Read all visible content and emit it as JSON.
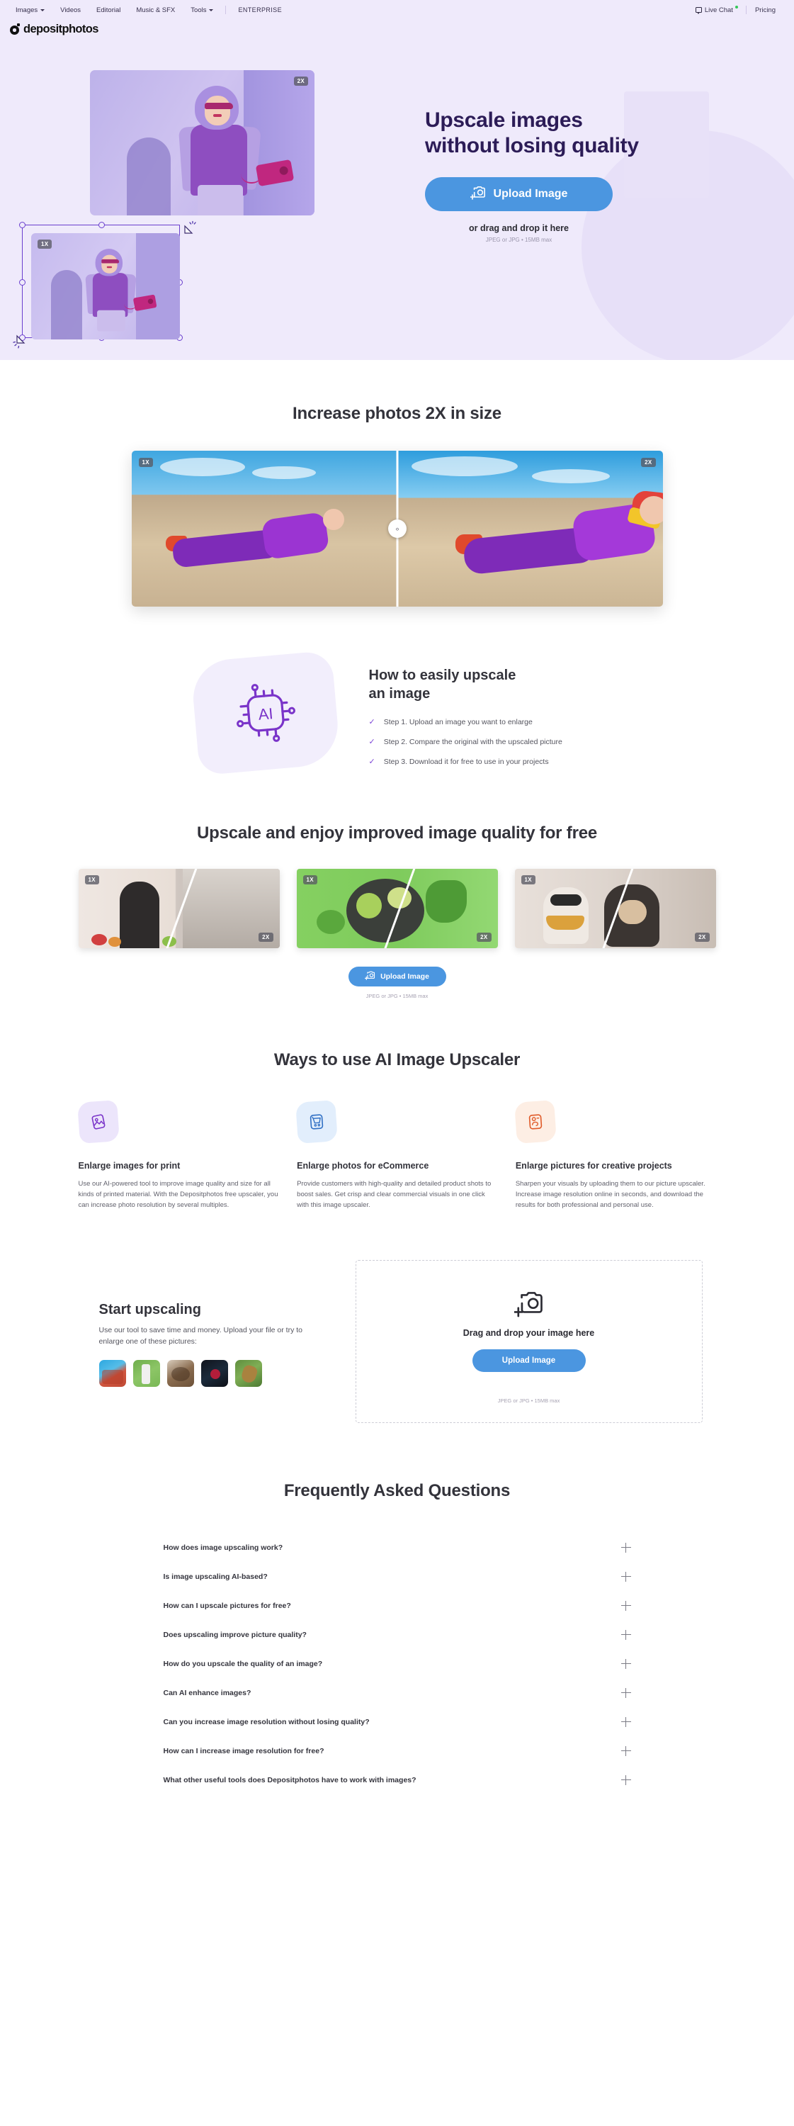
{
  "topbar": {
    "nav": [
      {
        "label": "Images",
        "has_caret": true
      },
      {
        "label": "Videos",
        "has_caret": false
      },
      {
        "label": "Editorial",
        "has_caret": false
      },
      {
        "label": "Music & SFX",
        "has_caret": false
      },
      {
        "label": "Tools",
        "has_caret": true
      }
    ],
    "enterprise": "ENTERPRISE",
    "live_chat": "Live Chat",
    "pricing": "Pricing"
  },
  "brand": {
    "name": "depositphotos"
  },
  "hero": {
    "title_line1": "Upscale images",
    "title_line2": "without losing quality",
    "upload_button": "Upload Image",
    "subtitle": "or drag and drop it here",
    "note": "JPEG or JPG • 15MB max",
    "badge_2x": "2X",
    "badge_1x": "1X"
  },
  "compare": {
    "title": "Increase photos 2X in size",
    "badge_left": "1X",
    "badge_right": "2X",
    "handle_glyph": "‹›"
  },
  "how": {
    "title_line1": "How to easily upscale",
    "title_line2": "an image",
    "icon_label": "AI",
    "steps": [
      "Step 1. Upload an image you want to enlarge",
      "Step 2. Compare the original with the upscaled picture",
      "Step 3. Download it for free to use in your projects"
    ]
  },
  "gallery": {
    "title": "Upscale and enjoy improved image quality for free",
    "cards": [
      {
        "badge_left": "1X",
        "badge_right": "2X"
      },
      {
        "badge_left": "1X",
        "badge_right": "2X"
      },
      {
        "badge_left": "1X",
        "badge_right": "2X"
      }
    ],
    "upload_button": "Upload Image",
    "note": "JPEG or JPG • 15MB max"
  },
  "ways": {
    "title": "Ways to use AI Image Upscaler",
    "items": [
      {
        "icon": "print-image-icon",
        "title": "Enlarge images for print",
        "text": "Use our AI-powered tool to improve image quality and size for all kinds of printed material. With the Depositphotos free upscaler, you can increase photo resolution by several multiples."
      },
      {
        "icon": "shopping-cart-icon",
        "title": "Enlarge photos for eCommerce",
        "text": "Provide customers with high-quality and detailed product shots to boost sales. Get crisp and clear commercial visuals in one click with this image upscaler."
      },
      {
        "icon": "creative-profile-icon",
        "title": "Enlarge pictures for creative projects",
        "text": "Sharpen your visuals by uploading them to our picture upscaler. Increase image resolution online in seconds, and download the results for both professional and personal use."
      }
    ]
  },
  "start": {
    "title": "Start upscaling",
    "text": "Use our tool to save time and money. Upload your file or try to enlarge one of these pictures:",
    "thumbnails": [
      "sample-1",
      "sample-2",
      "sample-3",
      "sample-4",
      "sample-5"
    ],
    "dropzone_title": "Drag and drop your image here",
    "upload_button": "Upload Image",
    "note": "JPEG or JPG • 15MB max"
  },
  "faq": {
    "title": "Frequently Asked Questions",
    "items": [
      "How does image upscaling work?",
      "Is image upscaling AI-based?",
      "How can I upscale pictures for free?",
      "Does upscaling improve picture quality?",
      "How do you upscale the quality of an image?",
      "Can AI enhance images?",
      "Can you increase image resolution without losing quality?",
      "How can I increase image resolution for free?",
      "What other useful tools does Depositphotos have to work with images?"
    ]
  },
  "colors": {
    "hero_bg": "#efeafb",
    "accent_blue": "#4b96e0",
    "hero_title": "#2c1c57",
    "purple": "#7c45d6"
  }
}
